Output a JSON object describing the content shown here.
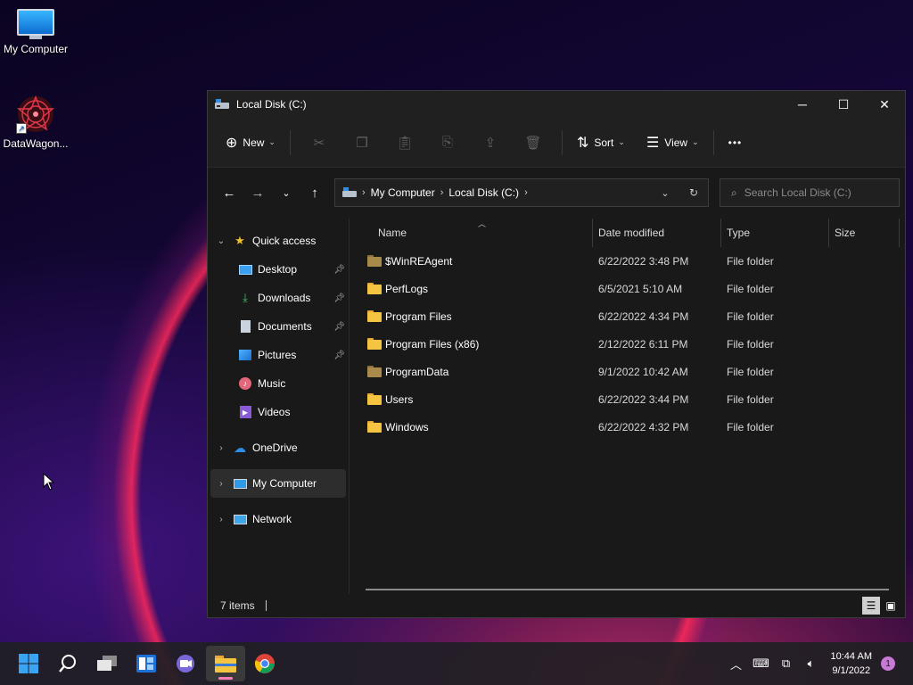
{
  "desktop": {
    "icons": [
      {
        "label": "My Computer",
        "icon": "monitor-icon"
      },
      {
        "label": "DataWagon...",
        "icon": "datawagon-icon"
      }
    ]
  },
  "window": {
    "title": "Local Disk (C:)",
    "controls": {
      "minimize": "─",
      "maximize": "☐",
      "close": "✕"
    }
  },
  "toolbar": {
    "new_label": "New",
    "sort_label": "Sort",
    "view_label": "View",
    "more_label": "•••"
  },
  "address": {
    "segments": [
      "My Computer",
      "Local Disk (C:)"
    ],
    "separator": "›"
  },
  "search": {
    "placeholder": "Search Local Disk (C:)"
  },
  "nav": {
    "quick_access": "Quick access",
    "items": [
      {
        "label": "Desktop",
        "icon": "desktop-icon"
      },
      {
        "label": "Downloads",
        "icon": "downloads-icon"
      },
      {
        "label": "Documents",
        "icon": "documents-icon"
      },
      {
        "label": "Pictures",
        "icon": "pictures-icon"
      },
      {
        "label": "Music",
        "icon": "music-icon"
      },
      {
        "label": "Videos",
        "icon": "videos-icon"
      }
    ],
    "onedrive": "OneDrive",
    "my_computer": "My Computer",
    "network": "Network"
  },
  "columns": {
    "name": "Name",
    "date": "Date modified",
    "type": "Type",
    "size": "Size"
  },
  "files": [
    {
      "name": "$WinREAgent",
      "date": "6/22/2022 3:48 PM",
      "type": "File folder",
      "hidden": true
    },
    {
      "name": "PerfLogs",
      "date": "6/5/2021 5:10 AM",
      "type": "File folder",
      "hidden": false
    },
    {
      "name": "Program Files",
      "date": "6/22/2022 4:34 PM",
      "type": "File folder",
      "hidden": false
    },
    {
      "name": "Program Files (x86)",
      "date": "2/12/2022 6:11 PM",
      "type": "File folder",
      "hidden": false
    },
    {
      "name": "ProgramData",
      "date": "9/1/2022 10:42 AM",
      "type": "File folder",
      "hidden": true
    },
    {
      "name": "Users",
      "date": "6/22/2022 3:44 PM",
      "type": "File folder",
      "hidden": false
    },
    {
      "name": "Windows",
      "date": "6/22/2022 4:32 PM",
      "type": "File folder",
      "hidden": false
    }
  ],
  "status": {
    "items": "7 items"
  },
  "taskbar": {
    "time": "10:44 AM",
    "date": "9/1/2022",
    "notifications": "1"
  }
}
